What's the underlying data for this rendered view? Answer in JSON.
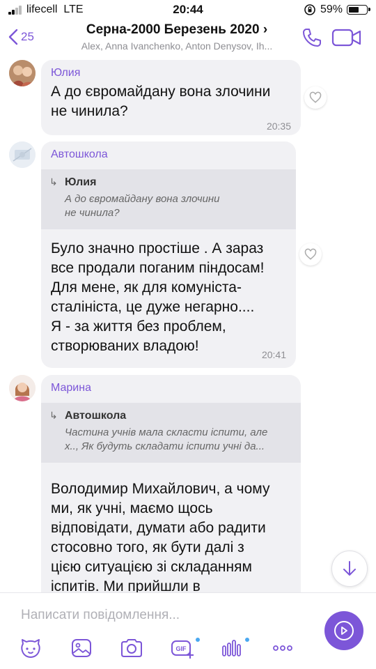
{
  "status_bar": {
    "carrier": "lifecell",
    "network": "LTE",
    "time": "20:44",
    "battery": "59%"
  },
  "header": {
    "back_count": "25",
    "title": "Серна-2000 Березень 2020",
    "title_chevron": "›",
    "subtitle": "Alex, Anna Ivanchenko, Anton Denysov, Ih..."
  },
  "messages": [
    {
      "sender": "Юлия",
      "text": "А до євромайдану вона злочини\nне чинила?",
      "time": "20:35"
    },
    {
      "sender": "Автошкола",
      "quote": {
        "name": "Юлия",
        "text": "А до євромайдану вона злочини\nне чинила?"
      },
      "text": "Було значно простіше . А зараз\nвсе продали поганим піндосам!\nДля мене, як для комуніста-\nсталініста, це дуже негарно....\nЯ - за життя без проблем,\nстворюваних владою!",
      "time": "20:41"
    },
    {
      "sender": "Марина",
      "quote": {
        "name": "Автошкола",
        "text": "Частина учнів мала скласти іспити, але\nх.., Як будуть складати іспити учні да..."
      },
      "text": "Володимир Михайлович, а чому\nми, як учні, маємо щось\nвідповідати, думати або радити\nстосовно того, як бути далі з\nцією ситуацією зі складанням\nіспитів. Ми прийшли в"
    }
  ],
  "composer": {
    "placeholder": "Написати повідомлення..."
  },
  "icons": {
    "status": [
      "signal-icon",
      "lock-rotation-icon",
      "battery-icon"
    ],
    "header": [
      "back-chevron-icon",
      "phone-icon",
      "video-icon"
    ],
    "chat": [
      "heart-icon",
      "reply-arrow-icon",
      "arrow-down-icon"
    ],
    "toolbar": [
      "sticker-icon",
      "image-icon",
      "camera-icon",
      "gif-icon",
      "voice-icon",
      "more-icon",
      "send-icon"
    ]
  },
  "colors": {
    "accent": "#7c56d8",
    "bubble": "#f1f1f4",
    "quote": "#e3e3e8",
    "muted": "#8e8e93",
    "dot": "#4aa8f0"
  }
}
